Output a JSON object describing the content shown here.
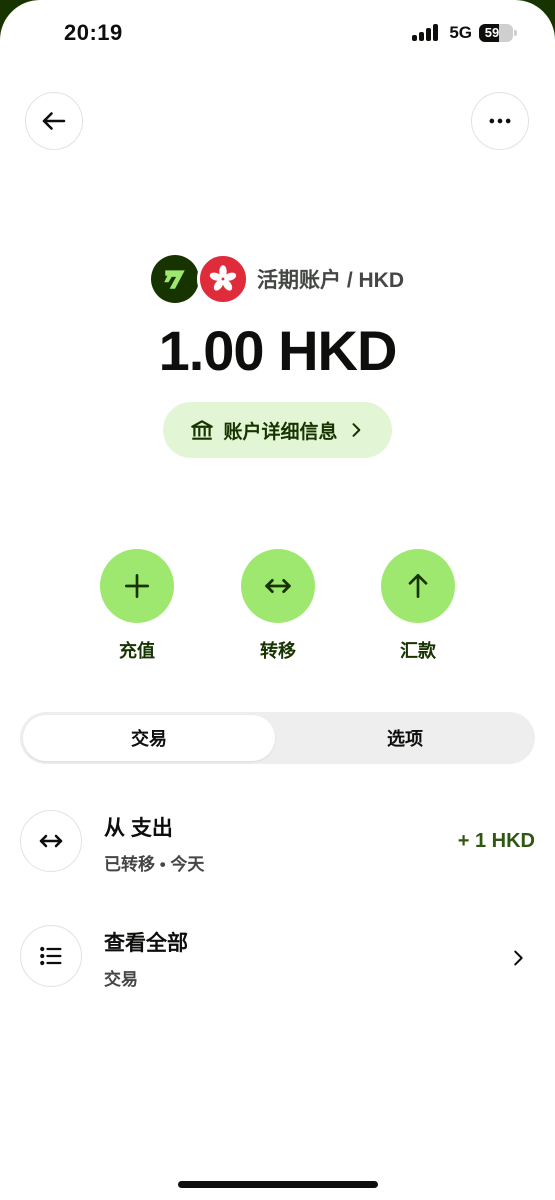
{
  "status_bar": {
    "time": "20:19",
    "network": "5G",
    "battery_level": "59",
    "battery_fraction": 0.59
  },
  "account": {
    "title": "活期账户 / HKD",
    "balance": "1.00 HKD",
    "details_label": "账户详细信息"
  },
  "actions": [
    {
      "label": "充值",
      "icon": "plus-icon"
    },
    {
      "label": "转移",
      "icon": "arrows-left-right-icon"
    },
    {
      "label": "汇款",
      "icon": "arrow-up-icon"
    }
  ],
  "tabs": {
    "active": "交易",
    "inactive": "选项"
  },
  "transactions": [
    {
      "title": "从 支出",
      "subtitle": "已转移 • 今天",
      "amount": "+ 1 HKD",
      "icon": "arrows-left-right-icon"
    }
  ],
  "view_all": {
    "title": "查看全部",
    "subtitle": "交易",
    "icon": "list-icon"
  },
  "colors": {
    "brand_dark": "#163300",
    "brand_green": "#9fe870",
    "pill_bg": "#e2f6d5",
    "amount_green": "#2f5711",
    "flag_red": "#e02b3a"
  }
}
